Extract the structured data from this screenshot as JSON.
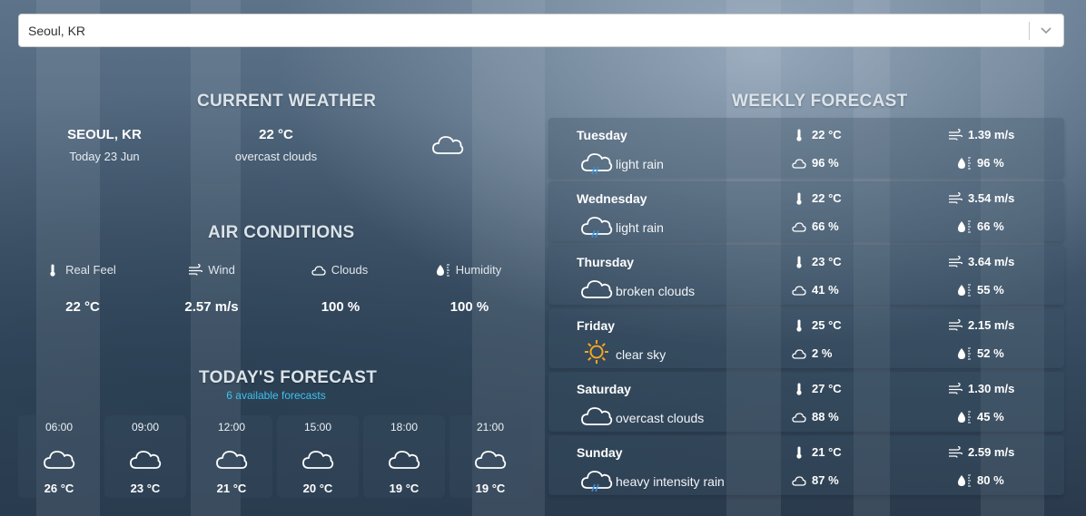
{
  "search": {
    "value": "Seoul, KR"
  },
  "current_weather": {
    "title": "CURRENT WEATHER",
    "city": "SEOUL, KR",
    "date": "Today 23 Jun",
    "temperature": "22 °C",
    "description": "overcast clouds",
    "icon": "cloud-icon"
  },
  "air_conditions": {
    "title": "AIR CONDITIONS",
    "items": [
      {
        "label": "Real Feel",
        "value": "22 °C",
        "icon": "thermometer-icon"
      },
      {
        "label": "Wind",
        "value": "2.57 m/s",
        "icon": "wind-icon"
      },
      {
        "label": "Clouds",
        "value": "100 %",
        "icon": "cloud-icon"
      },
      {
        "label": "Humidity",
        "value": "100 %",
        "icon": "humidity-icon"
      }
    ]
  },
  "todays_forecast": {
    "title": "TODAY'S FORECAST",
    "subtitle": "6 available forecasts",
    "items": [
      {
        "time": "06:00",
        "temp": "26 °C",
        "icon": "cloud-icon"
      },
      {
        "time": "09:00",
        "temp": "23 °C",
        "icon": "cloud-icon"
      },
      {
        "time": "12:00",
        "temp": "21 °C",
        "icon": "cloud-icon"
      },
      {
        "time": "15:00",
        "temp": "20 °C",
        "icon": "cloud-icon"
      },
      {
        "time": "18:00",
        "temp": "19 °C",
        "icon": "cloud-icon"
      },
      {
        "time": "21:00",
        "temp": "19 °C",
        "icon": "cloud-icon"
      }
    ]
  },
  "weekly_forecast": {
    "title": "WEEKLY FORECAST",
    "days": [
      {
        "day": "Tuesday",
        "desc": "light rain",
        "icon": "rain-cloud-icon",
        "temp": "22 °C",
        "wind": "1.39 m/s",
        "clouds": "96 %",
        "humidity": "96 %"
      },
      {
        "day": "Wednesday",
        "desc": "light rain",
        "icon": "rain-cloud-icon",
        "temp": "22 °C",
        "wind": "3.54 m/s",
        "clouds": "66 %",
        "humidity": "66 %"
      },
      {
        "day": "Thursday",
        "desc": "broken clouds",
        "icon": "cloud-icon",
        "temp": "23 °C",
        "wind": "3.64 m/s",
        "clouds": "41 %",
        "humidity": "55 %"
      },
      {
        "day": "Friday",
        "desc": "clear sky",
        "icon": "sun-icon",
        "temp": "25 °C",
        "wind": "2.15 m/s",
        "clouds": "2 %",
        "humidity": "52 %"
      },
      {
        "day": "Saturday",
        "desc": "overcast clouds",
        "icon": "cloud-icon",
        "temp": "27 °C",
        "wind": "1.30 m/s",
        "clouds": "88 %",
        "humidity": "45 %"
      },
      {
        "day": "Sunday",
        "desc": "heavy intensity rain",
        "icon": "rain-cloud-icon",
        "temp": "21 °C",
        "wind": "2.59 m/s",
        "clouds": "87 %",
        "humidity": "80 %"
      }
    ]
  },
  "colors": {
    "accent": "#3cc3f0",
    "sun": "#f5a623",
    "rain": "#3a8fd6"
  }
}
